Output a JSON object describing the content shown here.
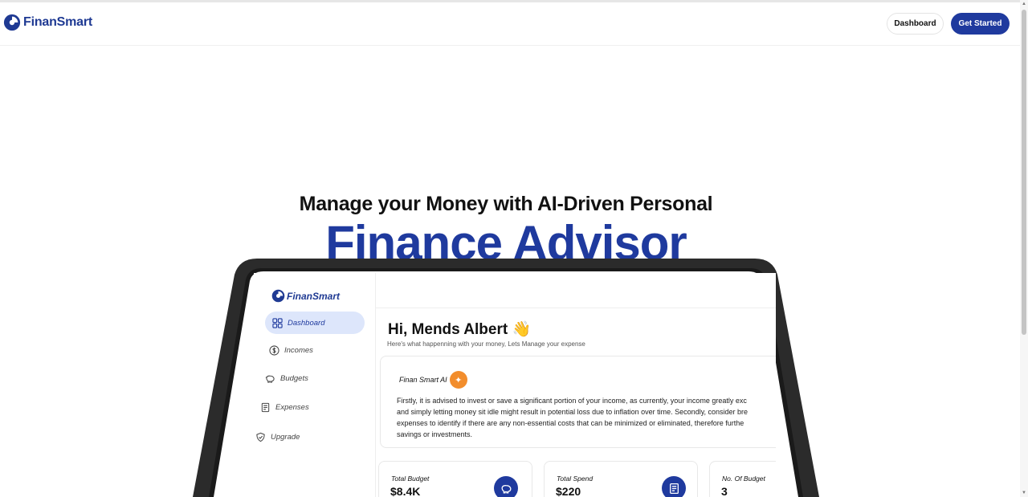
{
  "header": {
    "brand": "FinanSmart",
    "dashboard_label": "Dashboard",
    "get_started_label": "Get Started"
  },
  "hero": {
    "subtitle": "Manage your Money with AI-Driven Personal",
    "title": "Finance Advisor"
  },
  "app": {
    "brand": "FinanSmart",
    "nav": [
      {
        "label": "Dashboard",
        "icon": "grid-icon",
        "active": true
      },
      {
        "label": "Incomes",
        "icon": "dollar-circle-icon"
      },
      {
        "label": "Budgets",
        "icon": "piggy-bank-icon"
      },
      {
        "label": "Expenses",
        "icon": "receipt-icon"
      },
      {
        "label": "Upgrade",
        "icon": "shield-check-icon"
      }
    ],
    "greeting": "Hi, Mends Albert 👋",
    "greeting_sub": "Here's what happenning with your money, Lets Manage your expense",
    "ai": {
      "title": "Finan Smart AI",
      "lines": [
        "Firstly, it is advised to invest or save a significant portion of your income, as currently, your income greatly exc",
        "and simply letting money sit idle might result in potential loss due to inflation over time. Secondly, consider bre",
        "expenses to identify if there are any non-essential costs that can be minimized or eliminated, therefore furthe",
        "savings or investments."
      ]
    },
    "stats": [
      {
        "label": "Total Budget",
        "value": "$8.4K",
        "icon": "piggy-bank-icon"
      },
      {
        "label": "Total Spend",
        "value": "$220",
        "icon": "receipt-icon"
      },
      {
        "label": "No. Of Budget",
        "value": "3",
        "icon": "wallet-icon"
      }
    ]
  },
  "colors": {
    "brand_blue": "#1f3a9e",
    "active_nav_bg": "#dde6fb",
    "ai_badge": "#f28d2c"
  }
}
